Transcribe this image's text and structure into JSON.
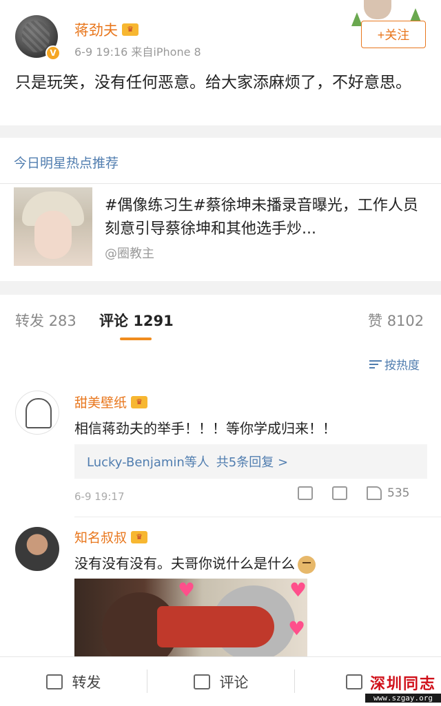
{
  "post": {
    "username": "蒋劲夫",
    "verified_badge": "V",
    "time": "6-9 19:16",
    "source": "来自iPhone 8",
    "follow_label": "+关注",
    "text": "只是玩笑，没有任何恶意。给大家添麻烦了，不好意思。"
  },
  "hot": {
    "title": "今日明星热点推荐",
    "text": "#偶像练习生#蔡徐坤未播录音曝光，工作人员刻意引导蔡徐坤和其他选手炒...",
    "source": "@圈教主"
  },
  "tabs": {
    "repost_label": "转发",
    "repost_count": "283",
    "comment_label": "评论",
    "comment_count": "1291",
    "like_label": "赞",
    "like_count": "8102"
  },
  "sort_label": "按热度",
  "comments": [
    {
      "username": "甜美壁纸",
      "text": "相信蒋劲夫的举手！！！等你学成归来！！",
      "replies_who": "Lucky-Benjamin等人",
      "replies_count": "共5条回复 >",
      "time": "6-9 19:17",
      "likes": "535"
    },
    {
      "username": "知名叔叔",
      "text": "没有没有没有。夫哥你说什么是什么"
    }
  ],
  "bottombar": {
    "repost": "转发",
    "comment": "评论"
  },
  "watermark": {
    "main": "深圳同志",
    "url": "www.szgay.org"
  },
  "colors": {
    "orange": "#e8761c",
    "link_blue": "#507daf",
    "tab_underline": "#f08c1e"
  }
}
